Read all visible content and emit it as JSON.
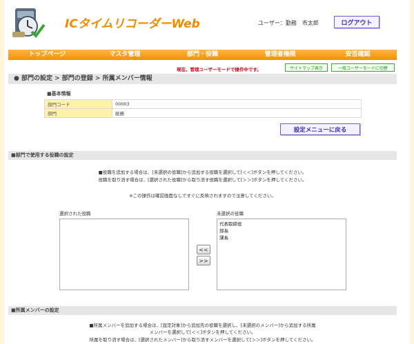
{
  "header": {
    "app_title": "ICタイムリコーダーWeb",
    "user_label": "ユーザー：勤務　市太郎",
    "logout_label": "ログアウト"
  },
  "nav": {
    "items": [
      "トップページ",
      "マスタ管理",
      "部門・役職",
      "管理者権限",
      "安否確認"
    ]
  },
  "mode": {
    "notice": "現在、管理ユーザーモードで操作中です。",
    "sitemap_label": "サイトマップ表示",
    "general_mode_label": "一般ユーザーモードに切替"
  },
  "breadcrumb": "● 部門の設定 > 部門の登録 > 所属メンバー情報",
  "basic_info": {
    "title": "■基本情報",
    "rows": [
      {
        "label": "部門コード",
        "value": "00003"
      },
      {
        "label": "部門",
        "value": "総務"
      }
    ]
  },
  "back_button": "設定メニューに戻る",
  "roles_section": {
    "title": "■部門で使用する役職の設定",
    "note1": "■役職を追加する場合は、[未選択の役職]から追加する役職を選択して[＜＜]ボタンを押してください。",
    "note2": "役職を取り消す場合は、[選択された役職]から取り消す役職を選択して[＞＞]ボタンを押してください。",
    "note3": "※この操作は確認画面なしですぐに反映されますので注意してください。",
    "selected_label": "選択された役職",
    "unselected_label": "未選択の役職",
    "selected_items": [],
    "unselected_items": [
      "代表取締役",
      "部長",
      "課長"
    ],
    "add_btn": "<<",
    "remove_btn": ">>"
  },
  "members_section": {
    "title": "■所属メンバーの設定",
    "note1": "■所属メンバーを追加する場合は、[設定対象]から追加先の役職を選択し、[未選択のメンバー]から追加する所属",
    "note2": "メンバーを選択して[＜＜]ボタンを押してください。",
    "note3": "所属を取り消す場合は、[選択されたメンバー]から取り消すメンバーを選択して[＞＞]ボタンを押してください。"
  }
}
